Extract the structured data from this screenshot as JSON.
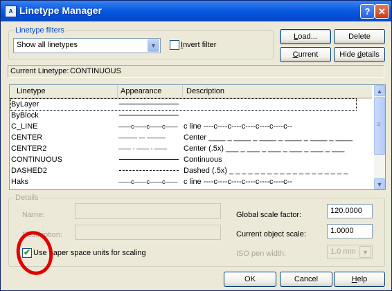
{
  "window": {
    "title": "Linetype Manager",
    "app_icon_text": "A",
    "help_glyph": "?",
    "close_glyph": "✕"
  },
  "filters": {
    "legend": "Linetype filters",
    "selected": "Show all linetypes",
    "invert_label_underlined": "I",
    "invert_label_rest": "nvert filter"
  },
  "buttons": {
    "load_ul": "L",
    "load_rest": "oad...",
    "delete": "Delete",
    "current_ul": "C",
    "current_rest": "urrent",
    "hide_pre": "Hide ",
    "hide_ul": "d",
    "hide_rest": "etails",
    "ok": "OK",
    "cancel": "Cancel",
    "help_ul": "H",
    "help_rest": "elp"
  },
  "current_linetype": {
    "label": "Current Linetype:",
    "value": "CONTINUOUS"
  },
  "list": {
    "columns": [
      "Linetype",
      "Appearance",
      "Description"
    ],
    "rows": [
      {
        "name": "ByLayer",
        "appearance": "solid",
        "description": ""
      },
      {
        "name": "ByBlock",
        "appearance": "solid",
        "description": ""
      },
      {
        "name": "C_LINE",
        "appearance": "——c——c——c——",
        "description": "c line ----c----c----c----c----c----c--"
      },
      {
        "name": "CENTER",
        "appearance": "——— —  ———",
        "description": "Center ____ _ ____ _ ____ _ ____ _ ____ _ ____"
      },
      {
        "name": "CENTER2",
        "appearance": "—— - —— - ——",
        "description": "Center (.5x) ___ _ ___ _ ___ _ ___ _ ___ _ ___"
      },
      {
        "name": "CONTINUOUS",
        "appearance": "solid",
        "description": "Continuous"
      },
      {
        "name": "DASHED2",
        "appearance": "dashed",
        "description": "Dashed (.5x) _ _ _ _ _ _ _ _ _ _ _ _ _ _ _ _ _ _ _"
      },
      {
        "name": "Haks",
        "appearance": "——c——c——c——",
        "description": "c line ----c----c----c----c----c----c--"
      }
    ],
    "scroll_up": "▲",
    "scroll_down": "▼",
    "thumb_grip": "≡"
  },
  "details": {
    "legend": "Details",
    "name_label": "Name:",
    "description_label": "Description:",
    "global_scale_label": "Global scale factor:",
    "global_scale_value": "120.0000",
    "object_scale_label": "Current object scale:",
    "object_scale_value": "1.0000",
    "iso_pen_label": "ISO pen width:",
    "iso_pen_value": "1.0 mm",
    "paper_space_label": "Use paper space units for scaling",
    "paper_space_checked": true
  },
  "colors": {
    "annotation_circle": "#e00000",
    "title_bar": "#0a5ce0",
    "group_legend": "#0046d5"
  }
}
